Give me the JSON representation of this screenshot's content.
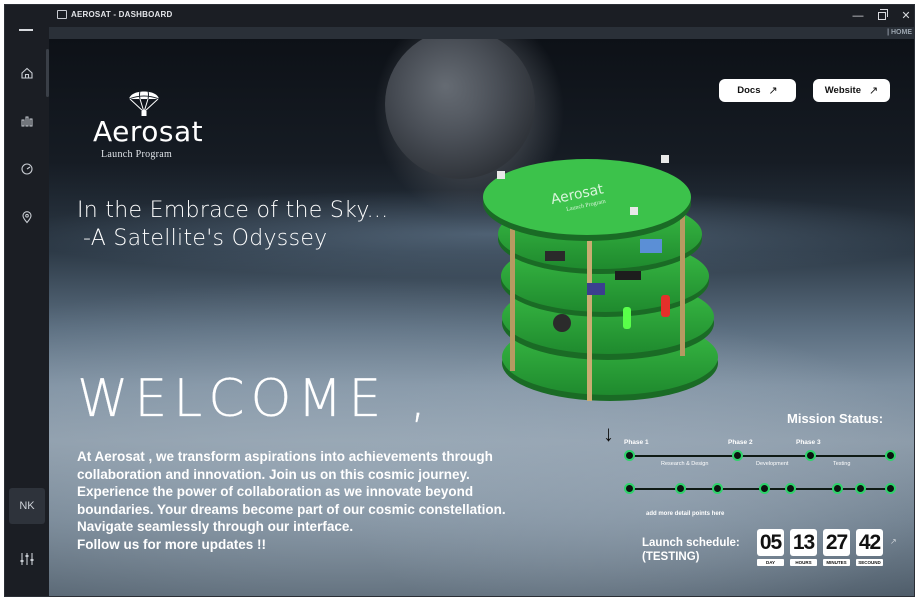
{
  "window": {
    "title": "AEROSAT - DASHBOARD"
  },
  "breadcrumb": "| HOME",
  "sidebar": {
    "items": [
      {
        "name": "home",
        "icon": "home-icon"
      },
      {
        "name": "stats",
        "icon": "bar-chart-icon"
      },
      {
        "name": "time",
        "icon": "clock-icon"
      },
      {
        "name": "location",
        "icon": "map-pin-icon"
      }
    ],
    "user_initials": "NK",
    "settings_icon": "sliders-icon"
  },
  "header_links": {
    "docs_label": "Docs",
    "website_label": "Website"
  },
  "logo": {
    "word": "Aerosat",
    "subtitle": "Launch Program"
  },
  "hero": {
    "tagline_1": "In the Embrace of the Sky...",
    "tagline_2": "-A Satellite's Odyssey",
    "welcome": "WELCOME ,",
    "body": "At Aerosat , we transform aspirations into achievements through collaboration and innovation. Join us on this cosmic journey. Experience the power of collaboration as we innovate beyond boundaries. Your dreams become part of our cosmic constellation.\nNavigate seamlessly through our interface.\nFollow us for more updates !!"
  },
  "satellite": {
    "board_label": "Aerosat",
    "board_sub": "Launch Program"
  },
  "mission": {
    "title": "Mission Status:",
    "phases": [
      "Phase 1",
      "Phase 2",
      "Phase 3"
    ],
    "steps": [
      "Research & Design",
      "Development",
      "Testing"
    ],
    "detail_note": "add more detail points here"
  },
  "launch": {
    "label_1": "Launch schedule:",
    "label_2": "(TESTING)",
    "countdown": [
      {
        "value": "05",
        "unit": "DAY"
      },
      {
        "value": "13",
        "unit": "HOURS"
      },
      {
        "value": "27",
        "unit": "MINUTES"
      },
      {
        "value": "42",
        "unit": "SECOUND"
      }
    ]
  },
  "colors": {
    "accent_green": "#2fd36b",
    "board_green": "#2fa63a",
    "sidebar_bg": "#1b1e24"
  }
}
